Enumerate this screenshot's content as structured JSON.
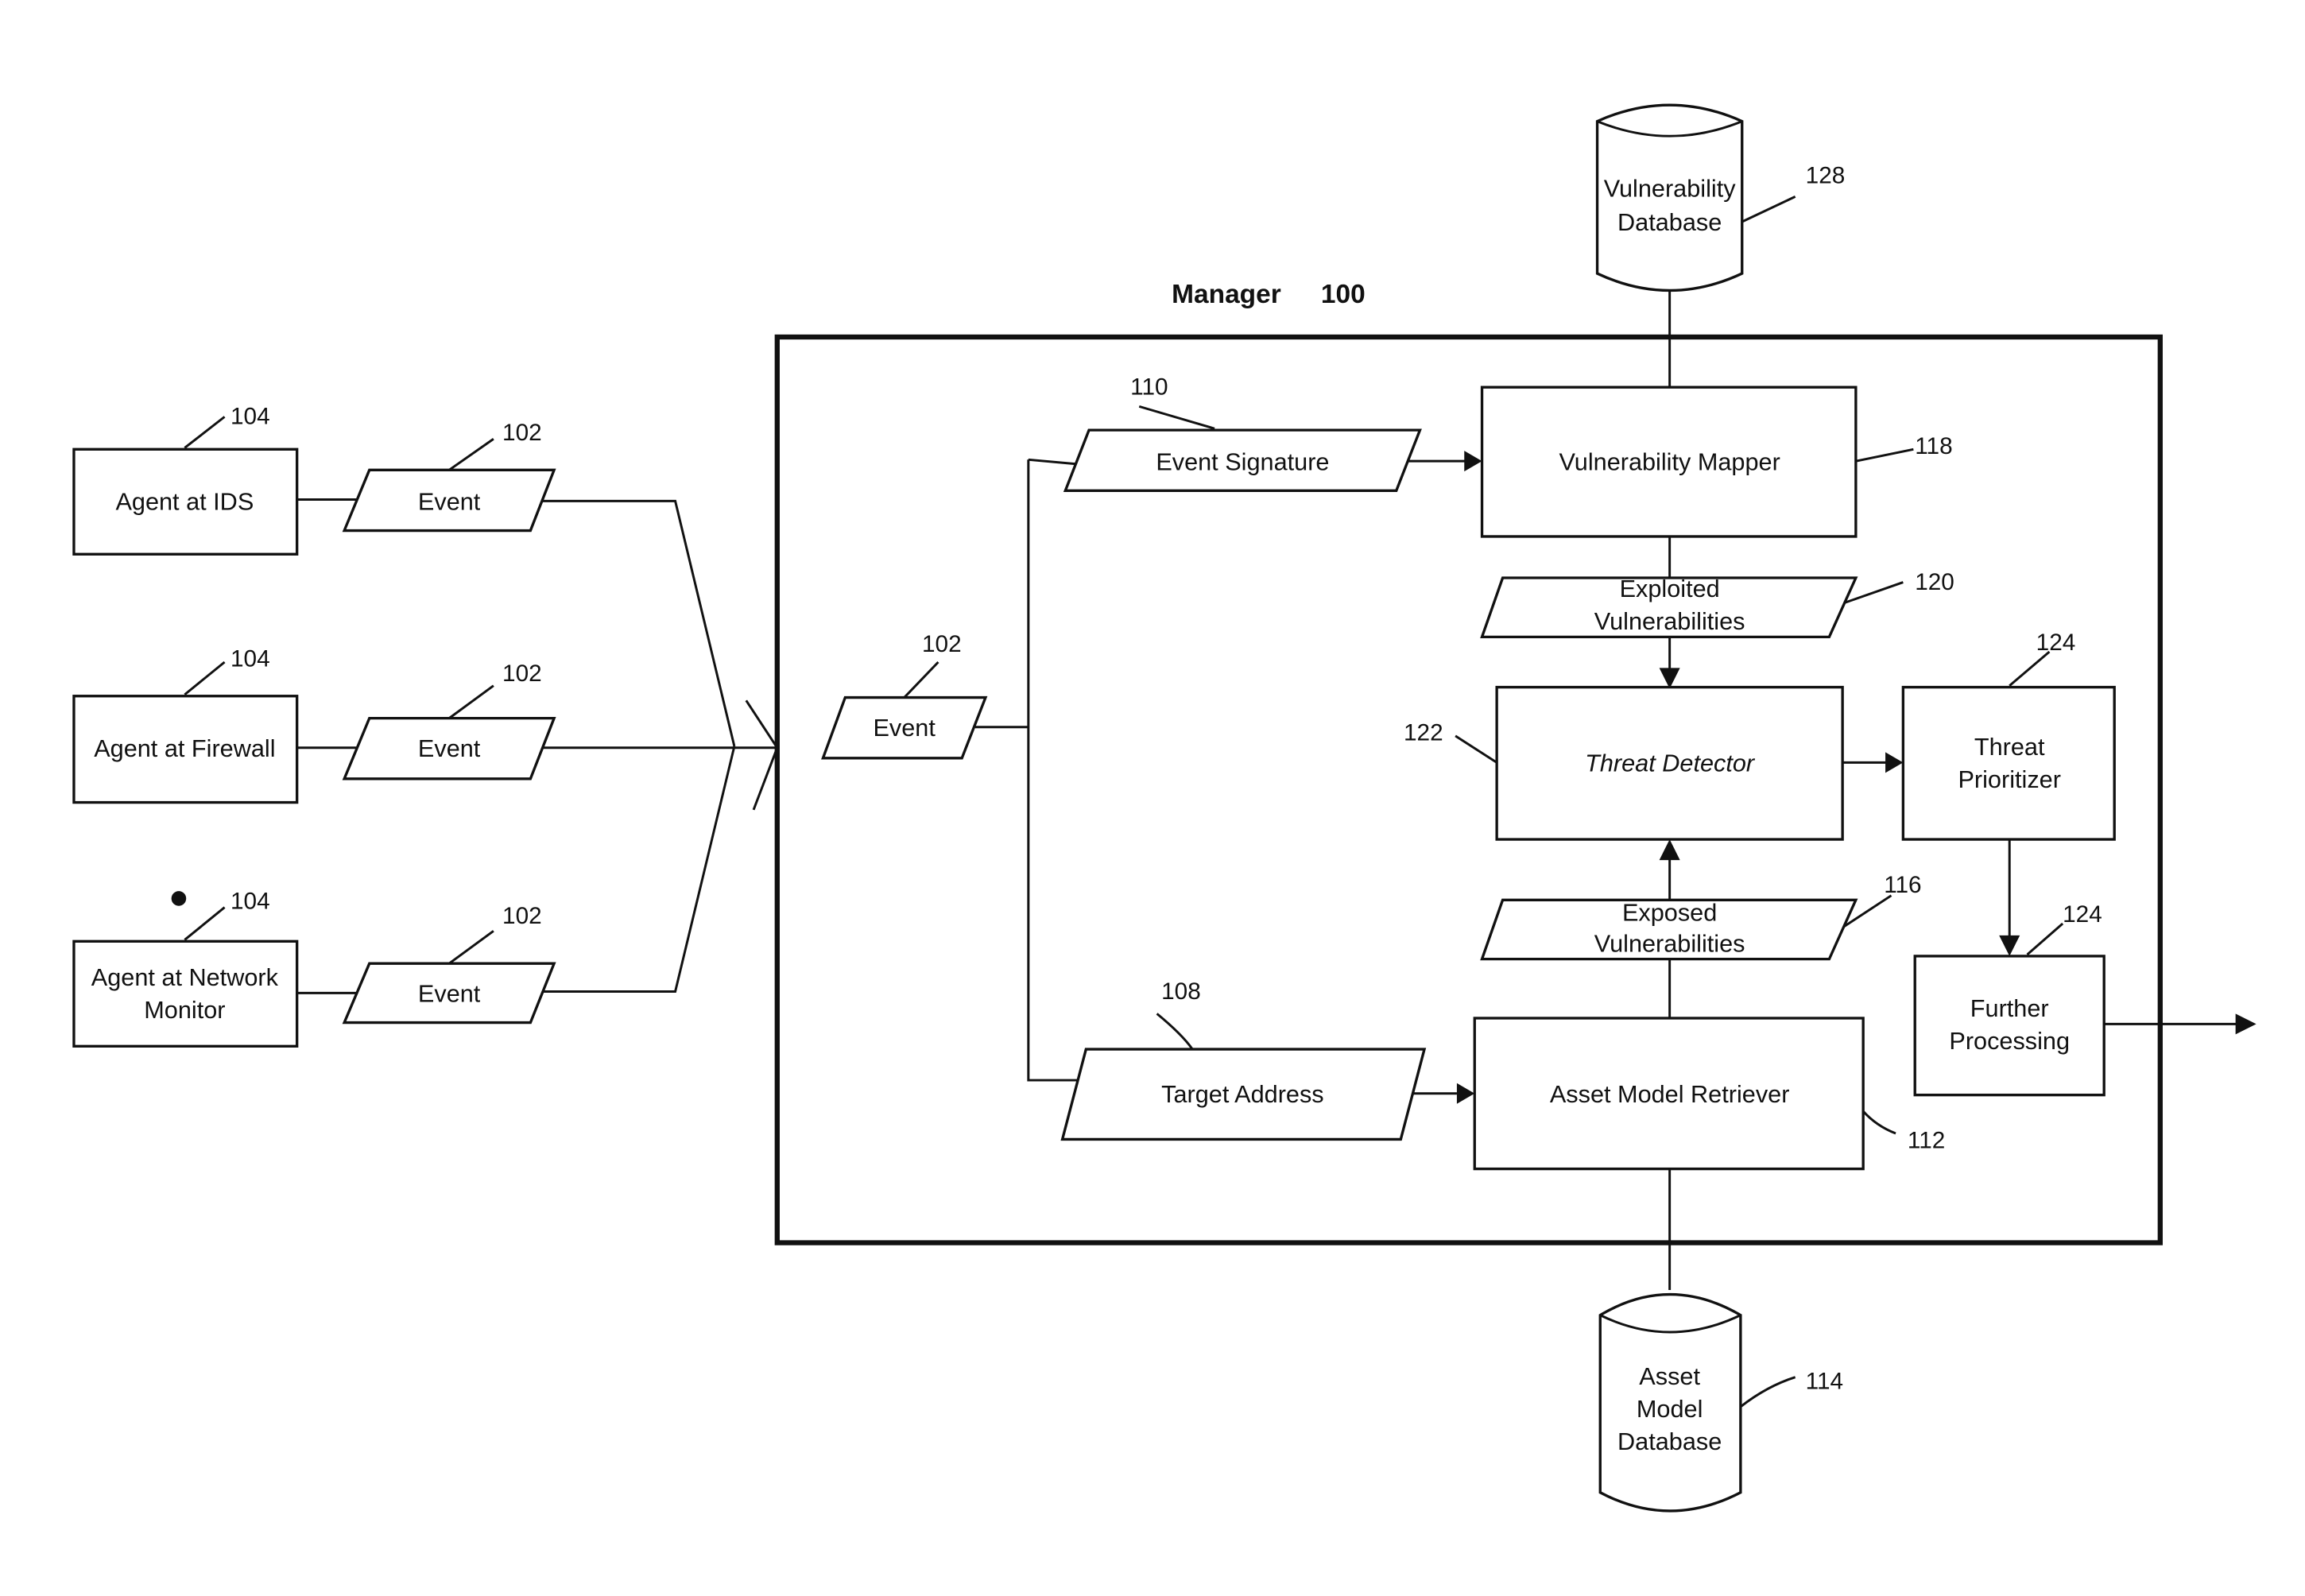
{
  "manager": {
    "title": "Manager",
    "ref": "100"
  },
  "agents": [
    {
      "label_lines": [
        "Agent at IDS"
      ],
      "ref": "104",
      "event_label": "Event",
      "event_ref": "102"
    },
    {
      "label_lines": [
        "Agent at Firewall"
      ],
      "ref": "104",
      "event_label": "Event",
      "event_ref": "102"
    },
    {
      "label_lines": [
        "Agent at Network",
        "Monitor"
      ],
      "ref": "104",
      "event_label": "Event",
      "event_ref": "102"
    }
  ],
  "inner_event": {
    "label": "Event",
    "ref": "102"
  },
  "event_signature": {
    "label": "Event Signature",
    "ref": "110"
  },
  "target_address": {
    "label": "Target Address",
    "ref": "108"
  },
  "vulnerability_mapper": {
    "label": "Vulnerability Mapper",
    "ref": "118"
  },
  "exploited_vulnerabilities": {
    "label_lines": [
      "Exploited",
      "Vulnerabilities"
    ],
    "ref": "120"
  },
  "threat_detector": {
    "label": "Threat Detector",
    "ref": "122"
  },
  "threat_prioritizer": {
    "label_lines": [
      "Threat",
      "Prioritizer"
    ],
    "ref": "124"
  },
  "exposed_vulnerabilities": {
    "label_lines": [
      "Exposed",
      "Vulnerabilities"
    ],
    "ref": "116"
  },
  "further_processing": {
    "label_lines": [
      "Further",
      "Processing"
    ],
    "ref": "124"
  },
  "asset_model_retriever": {
    "label": "Asset Model Retriever",
    "ref": "112"
  },
  "vulnerability_database": {
    "label_lines": [
      "Vulnerability",
      "Database"
    ],
    "ref": "128"
  },
  "asset_model_database": {
    "label_lines": [
      "Asset",
      "Model",
      "Database"
    ],
    "ref": "114"
  }
}
